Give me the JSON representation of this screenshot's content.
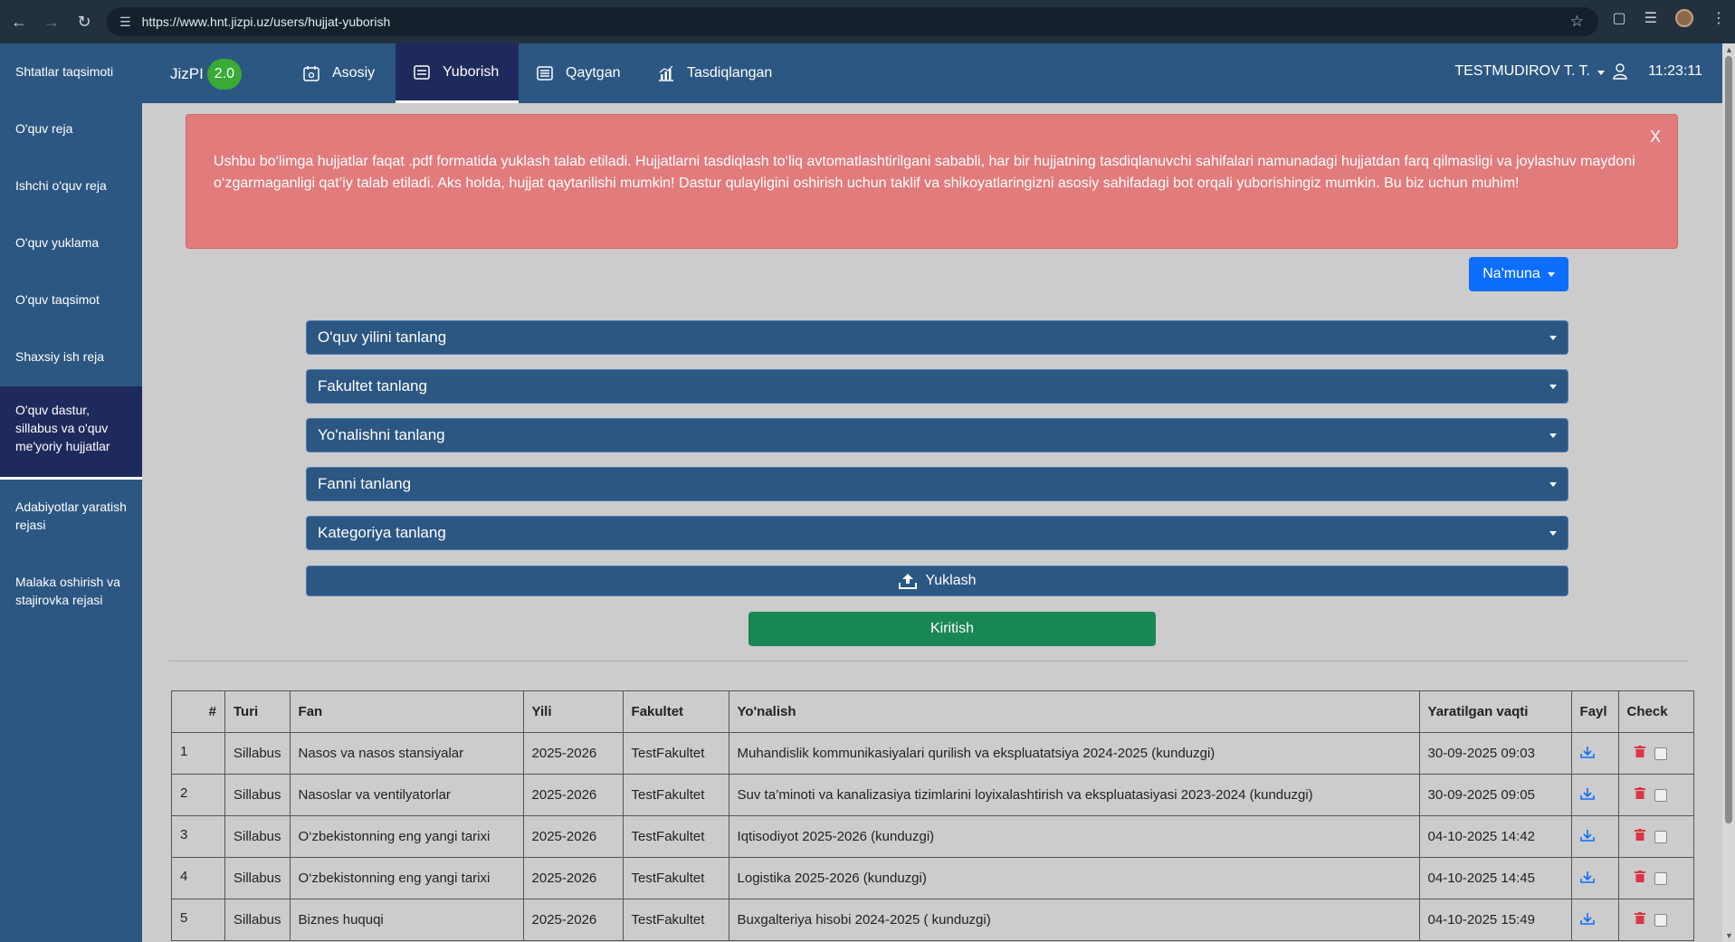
{
  "browser": {
    "url": "https://www.hnt.jizpi.uz/users/hujjat-yuborish"
  },
  "sidebar": {
    "items": [
      {
        "label": "Shtatlar taqsimoti"
      },
      {
        "label": "O'quv reja"
      },
      {
        "label": "Ishchi o'quv reja"
      },
      {
        "label": "O'quv yuklama"
      },
      {
        "label": "O'quv taqsimot"
      },
      {
        "label": "Shaxsiy ish reja"
      },
      {
        "label": "O'quv dastur, sillabus va o'quv me'yoriy hujjatlar",
        "active": true
      },
      {
        "label": "Adabiyotlar yaratish rejasi"
      },
      {
        "label": "Malaka oshirish va stajirovka rejasi"
      }
    ]
  },
  "brand": {
    "name": "JizPI",
    "version": "2.0"
  },
  "topnav": {
    "tabs": [
      {
        "label": "Asosiy",
        "icon": "calendar-icon"
      },
      {
        "label": "Yuborish",
        "icon": "list-icon",
        "active": true
      },
      {
        "label": "Qaytgan",
        "icon": "list-alt-icon"
      },
      {
        "label": "Tasdiqlangan",
        "icon": "chart-icon"
      }
    ],
    "user": "TESTMUDIROV T. T.",
    "time": "11:23:11"
  },
  "alert": {
    "text": "Ushbu bo‘limga hujjatlar faqat .pdf formatida yuklash talab etiladi. Hujjatlarni tasdiqlash to‘liq avtomatlashtirilgani sababli, har bir hujjatning tasdiqlanuvchi sahifalari namunadagi hujjatdan farq qilmasligi va joylashuv maydoni o‘zgarmaganligi qat’iy talab etiladi. Aks holda, hujjat qaytarilishi mumkin! Dastur qulayligini oshirish uchun taklif va shikoyatlaringizni asosiy sahifadagi bot orqali yuborishingiz mumkin. Bu biz uchun muhim!",
    "close": "X"
  },
  "namuna_label": "Na'muna",
  "form": {
    "selects": [
      {
        "label": "O'quv yilini tanlang"
      },
      {
        "label": "Fakultet tanlang"
      },
      {
        "label": "Yo'nalishni tanlang"
      },
      {
        "label": "Fanni tanlang"
      },
      {
        "label": "Kategoriya tanlang"
      }
    ],
    "upload_label": "Yuklash",
    "submit_label": "Kiritish"
  },
  "table": {
    "headers": [
      "#",
      "Turi",
      "Fan",
      "Yili",
      "Fakultet",
      "Yo'nalish",
      "Yaratilgan vaqti",
      "Fayl",
      "Check"
    ],
    "rows": [
      [
        "1",
        "Sillabus",
        "Nasos va nasos stansiyalar",
        "2025-2026",
        "TestFakultet",
        "Muhandislik kommunikasiyalari qurilish va ekspluatatsiya 2024-2025 (kunduzgi)",
        "30-09-2025 09:03"
      ],
      [
        "2",
        "Sillabus",
        "Nasoslar va ventilyatorlar",
        "2025-2026",
        "TestFakultet",
        "Suv ta’minoti va kanalizasiya tizimlarini loyixalashtirish va ekspluatasiyasi 2023-2024 (kunduzgi)",
        "30-09-2025 09:05"
      ],
      [
        "3",
        "Sillabus",
        "O‘zbekistonning eng yangi tarixi",
        "2025-2026",
        "TestFakultet",
        "Iqtisodiyot 2025-2026 (kunduzgi)",
        "04-10-2025 14:42"
      ],
      [
        "4",
        "Sillabus",
        "O‘zbekistonning eng yangi tarixi",
        "2025-2026",
        "TestFakultet",
        "Logistika 2025-2026 (kunduzgi)",
        "04-10-2025 14:45"
      ],
      [
        "5",
        "Sillabus",
        "Biznes huquqi",
        "2025-2026",
        "TestFakultet",
        "Buxgalteriya hisobi 2024-2025 ( kunduzgi)",
        "04-10-2025 15:49"
      ]
    ]
  },
  "colors": {
    "primary": "#2c5783",
    "active": "#1f2a5c",
    "alert": "#e27b7c",
    "success": "#198754",
    "blue": "#0d6efd",
    "badge": "#3aaa36"
  }
}
